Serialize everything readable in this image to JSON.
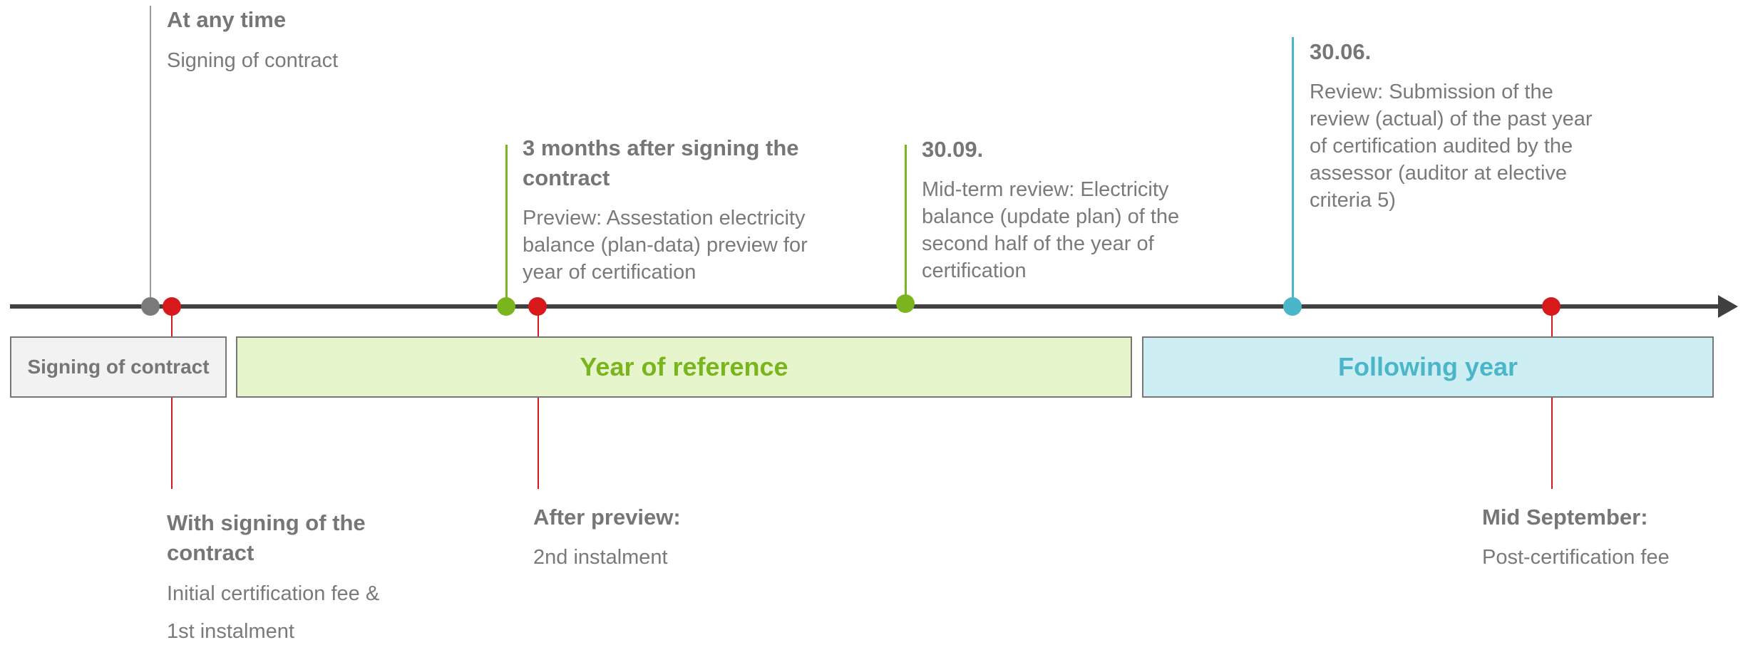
{
  "colors": {
    "axis": "#404040",
    "gray": "#7a7a7a",
    "red": "#d7191c",
    "green": "#7ab51d",
    "teal": "#4bb6c9",
    "green_fill": "#e6f5cc",
    "teal_fill": "#cdeef2",
    "gray_fill": "#f2f2f2"
  },
  "phases": {
    "signing": "Signing of contract",
    "reference": "Year of reference",
    "following": "Following year"
  },
  "milestones": {
    "any_time": {
      "title": "At any time",
      "text": "Signing of contract"
    },
    "three_months": {
      "title": "3 months after signing the contract",
      "text": "Preview: Assestation electricity balance (plan-data) preview for year of certification"
    },
    "sept30": {
      "title": "30.09.",
      "text": "Mid-term review: Electricity balance (update plan) of the second half of the year of certification"
    },
    "june30": {
      "title": "30.06.",
      "text": "Review: Submission of the review (actual) of the past year of certification audited by the assessor (auditor at elective criteria 5)"
    }
  },
  "payments": {
    "with_signing": {
      "title": "With signing of the contract",
      "line1": "Initial certification fee &",
      "line2": "1st instalment"
    },
    "after_preview": {
      "title": "After preview:",
      "text": "2nd instalment"
    },
    "mid_september": {
      "title": "Mid September:",
      "text": "Post-certification fee"
    }
  }
}
